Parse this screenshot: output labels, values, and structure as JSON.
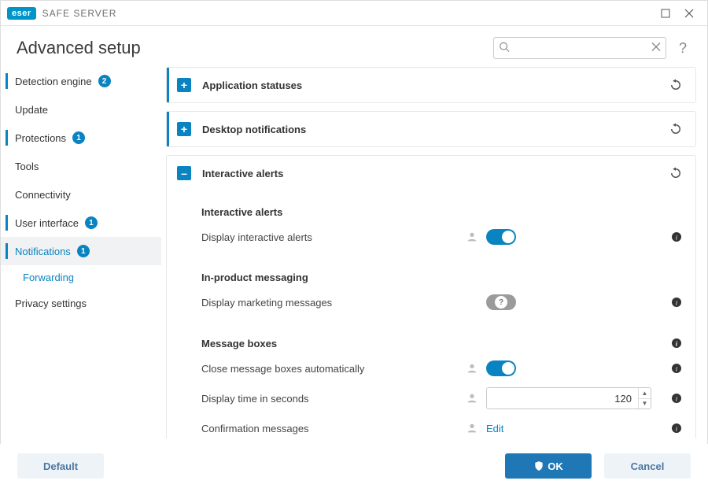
{
  "brand": {
    "logo": "eser",
    "name": "SAFE SERVER"
  },
  "window": {
    "maximize": "maximize",
    "close": "close"
  },
  "header": {
    "title": "Advanced setup",
    "search_placeholder": "",
    "help": "?"
  },
  "sidebar": {
    "items": [
      {
        "label": "Detection engine",
        "badge": "2",
        "marked": true
      },
      {
        "label": "Update"
      },
      {
        "label": "Protections",
        "badge": "1",
        "marked": true
      },
      {
        "label": "Tools"
      },
      {
        "label": "Connectivity"
      },
      {
        "label": "User interface",
        "badge": "1",
        "marked": true
      },
      {
        "label": "Notifications",
        "badge": "1",
        "marked": true,
        "active": true
      },
      {
        "label": "Forwarding",
        "sub": true,
        "active_sub": true
      },
      {
        "label": "Privacy settings"
      }
    ]
  },
  "sections": {
    "app_statuses": {
      "title": "Application statuses",
      "collapsed": true
    },
    "desktop_notifications": {
      "title": "Desktop notifications",
      "collapsed": true
    },
    "interactive_alerts": {
      "title": "Interactive alerts",
      "collapsed": false,
      "groups": {
        "alerts": {
          "heading": "Interactive alerts",
          "display_alerts": {
            "label": "Display interactive alerts",
            "value": true
          }
        },
        "messaging": {
          "heading": "In-product messaging",
          "marketing": {
            "label": "Display marketing messages",
            "value": null
          }
        },
        "boxes": {
          "heading": "Message boxes",
          "close_auto": {
            "label": "Close message boxes automatically",
            "value": true
          },
          "display_time": {
            "label": "Display time in seconds",
            "value": "120"
          },
          "confirmation": {
            "label": "Confirmation messages",
            "action": "Edit"
          }
        }
      }
    }
  },
  "footer": {
    "default": "Default",
    "ok": "OK",
    "cancel": "Cancel"
  }
}
